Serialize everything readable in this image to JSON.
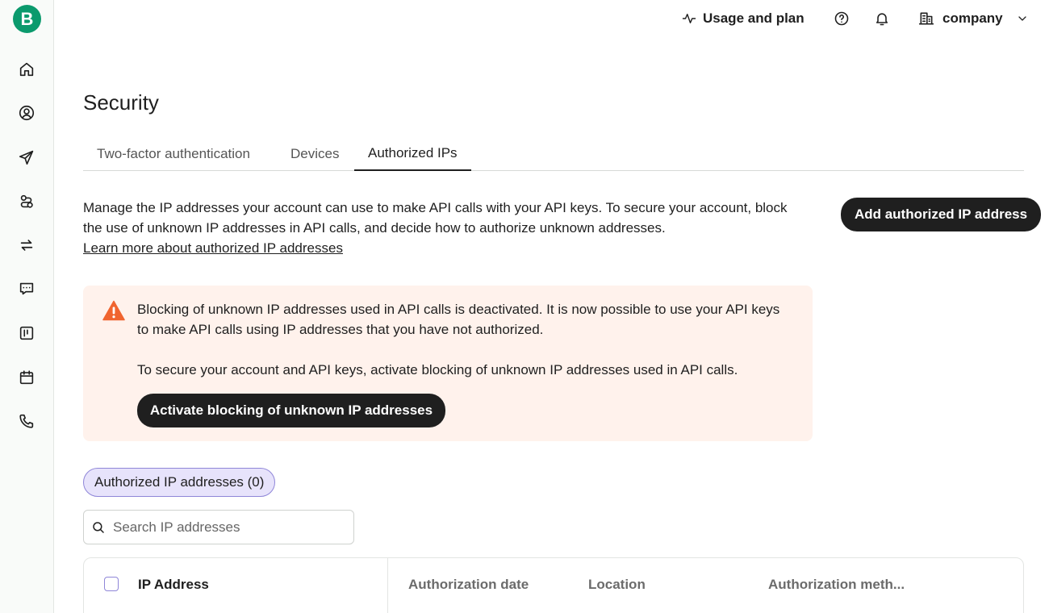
{
  "brand": {
    "logo_letter": "B",
    "accent": "#0b9a6d"
  },
  "sidebar": {
    "items": [
      {
        "name": "home",
        "icon": "home-icon"
      },
      {
        "name": "contacts",
        "icon": "user-circle-icon"
      },
      {
        "name": "campaigns",
        "icon": "send-icon"
      },
      {
        "name": "automations",
        "icon": "automation-icon"
      },
      {
        "name": "transactional",
        "icon": "transfer-icon"
      },
      {
        "name": "conversations",
        "icon": "chat-icon"
      },
      {
        "name": "sales",
        "icon": "board-icon"
      },
      {
        "name": "meetings",
        "icon": "calendar-icon"
      },
      {
        "name": "phone",
        "icon": "phone-icon"
      }
    ]
  },
  "topbar": {
    "usage_label": "Usage and plan",
    "help_icon": "help-icon",
    "notifications_icon": "bell-icon",
    "company_label": "company"
  },
  "page": {
    "title": "Security",
    "tabs": [
      {
        "label": "Two-factor authentication",
        "active": false
      },
      {
        "label": "Devices",
        "active": false
      },
      {
        "label": "Authorized IPs",
        "active": true
      }
    ],
    "description": "Manage the IP addresses your account can use to make API calls with your API keys. To secure your account, block the use of unknown IP addresses in API calls, and decide how to authorize unknown addresses.",
    "learn_more": "Learn more about authorized IP addresses",
    "add_button": "Add authorized IP address"
  },
  "alert": {
    "color": "#fff2ec",
    "icon_color": "#f0642f",
    "message": "Blocking of unknown IP addresses used in API calls is deactivated. It is now possible to use your API keys to make API calls using IP addresses that you have not authorized.",
    "recommendation": "To secure your account and API keys, activate blocking of unknown IP addresses used in API calls.",
    "action_button": "Activate blocking of unknown IP addresses"
  },
  "filter": {
    "chip_label": "Authorized IP addresses (0)"
  },
  "search": {
    "placeholder": "Search IP addresses",
    "value": ""
  },
  "table": {
    "columns": [
      "IP Address",
      "Authorization date",
      "Location",
      "Authorization meth..."
    ],
    "rows": []
  }
}
